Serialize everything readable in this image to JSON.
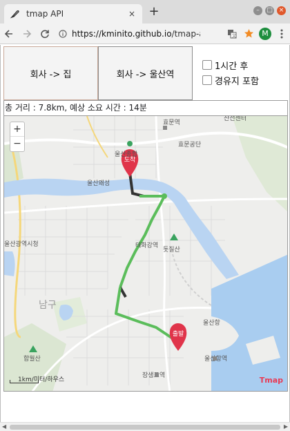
{
  "browser": {
    "tab_title": "tmap API",
    "tab_close": "×",
    "new_tab": "+",
    "url_host": "https://kminito.github.io",
    "url_path": "/tmap-ap...",
    "avatar_letter": "M",
    "icons": [
      "back-icon",
      "forward-icon",
      "reload-icon",
      "info-icon",
      "translate-icon",
      "star-icon",
      "menu-icon"
    ]
  },
  "buttons": {
    "to_home": "회사 -> 집",
    "to_ulsan_station": "회사 -> 울산역"
  },
  "options": {
    "one_hour_later": "1시간 후",
    "include_waypoint": "경유지 포함"
  },
  "summary": "총 거리 : 7.8km, 예상 소요 시간 : 14분",
  "map": {
    "zoom_in": "+",
    "zoom_out": "−",
    "scale_text": "1km/미터/하우스",
    "logo": "Tmap",
    "markers": {
      "destination": "도착",
      "start": "출발"
    },
    "labels": {
      "ulsan_general": "울산종합",
      "hyomun_station": "효문역",
      "hyomun_industrial": "효문공단",
      "sanjeon": "산전센터",
      "ulsan_wasaeng": "울산왜성",
      "taehwagang_station": "태화강역",
      "dotjilsan": "돗질산",
      "ulsan_city_hall": "울산광역시청",
      "nam_gu": "남구",
      "ulsan_port": "울산항",
      "ulsan_port_station": "울산항역",
      "jangsaengpo_station": "장생포역",
      "hamwolsan": "함월산"
    },
    "colors": {
      "route": "#5bbd5b",
      "route_dark": "#333333",
      "river": "#b9d4f2",
      "sea": "#a9cdf0",
      "marker": "#e0344a"
    }
  }
}
